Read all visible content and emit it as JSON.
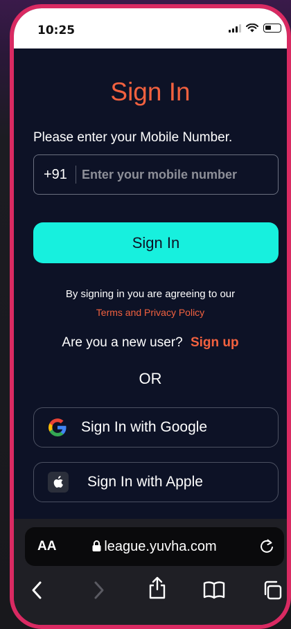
{
  "status_bar": {
    "time": "10:25"
  },
  "page": {
    "title": "Sign In",
    "prompt": "Please enter your Mobile Number.",
    "country_code": "+91",
    "mobile_placeholder": "Enter your mobile number",
    "mobile_value": "",
    "signin_label": "Sign In",
    "agree_text": "By signing in you are agreeing to our",
    "terms_link": "Terms and Privacy Policy",
    "new_user_text": "Are you a new user?",
    "signup_link": "Sign up",
    "or_text": "OR",
    "google_label": "Sign In with Google",
    "apple_label": "Sign In with Apple"
  },
  "browser": {
    "text_size_label": "AA",
    "url": "league.yuvha.com",
    "icons": [
      "lock-icon",
      "reload-icon",
      "back-icon",
      "forward-icon",
      "share-icon",
      "bookmarks-icon",
      "tabs-icon"
    ]
  },
  "colors": {
    "accent_orange": "#f2613f",
    "accent_cyan": "#17f0de",
    "background": "#0d1226",
    "frame": "#d92a62"
  }
}
